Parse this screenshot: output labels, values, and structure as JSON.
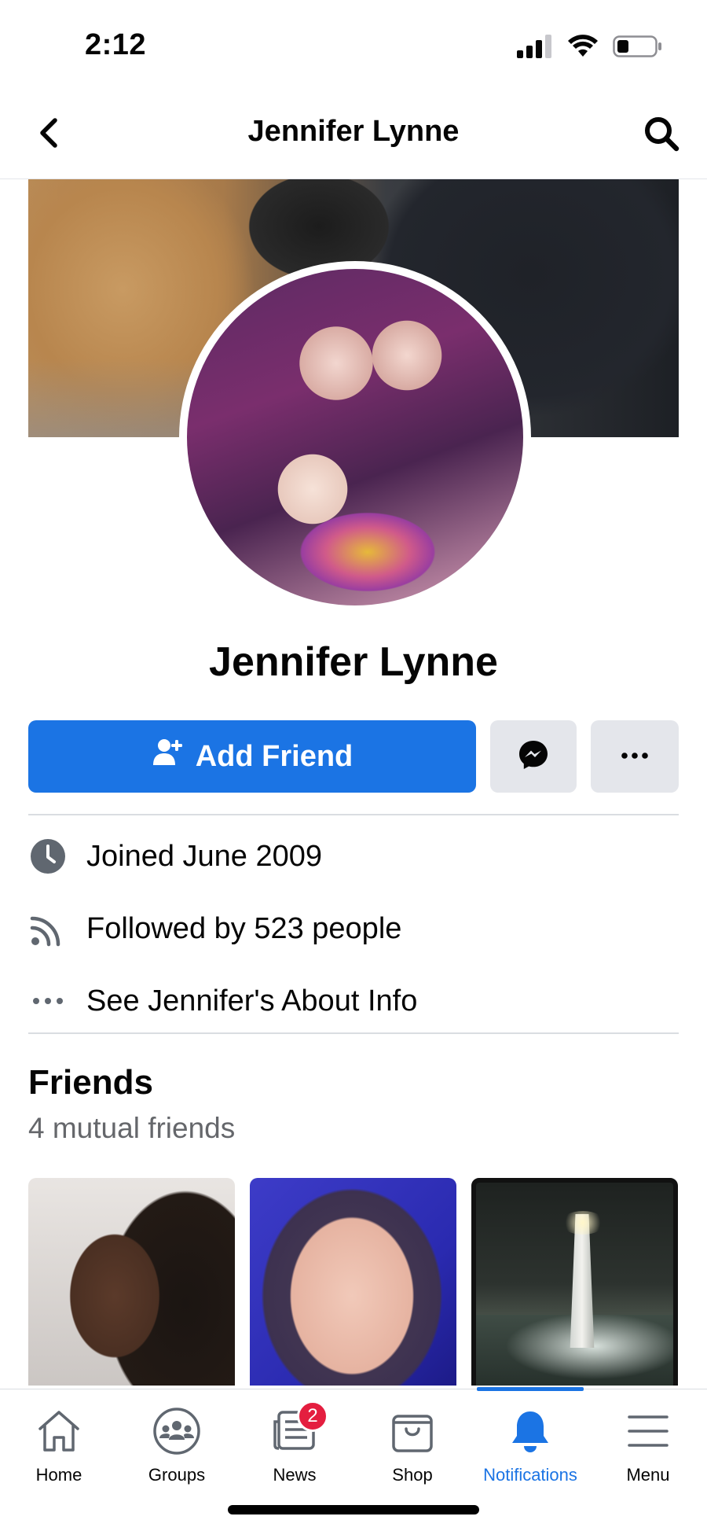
{
  "status_bar": {
    "time": "2:12"
  },
  "header": {
    "title": "Jennifer Lynne"
  },
  "profile": {
    "name": "Jennifer Lynne"
  },
  "actions": {
    "add_friend_label": "Add Friend"
  },
  "info": {
    "joined": "Joined June 2009",
    "followed": "Followed by 523 people",
    "about": "See Jennifer's About Info"
  },
  "friends": {
    "title": "Friends",
    "subtitle": "4 mutual friends"
  },
  "tabs": [
    {
      "label": "Home",
      "icon": "home-icon"
    },
    {
      "label": "Groups",
      "icon": "groups-icon"
    },
    {
      "label": "News",
      "icon": "news-icon",
      "badge": "2"
    },
    {
      "label": "Shop",
      "icon": "shop-icon"
    },
    {
      "label": "Notifications",
      "icon": "bell-icon",
      "active": true
    },
    {
      "label": "Menu",
      "icon": "hamburger-icon"
    }
  ],
  "colors": {
    "accent": "#1b74e4",
    "badge": "#e41e3f",
    "button_gray": "#e4e6eb",
    "secondary_text": "#65676b"
  }
}
